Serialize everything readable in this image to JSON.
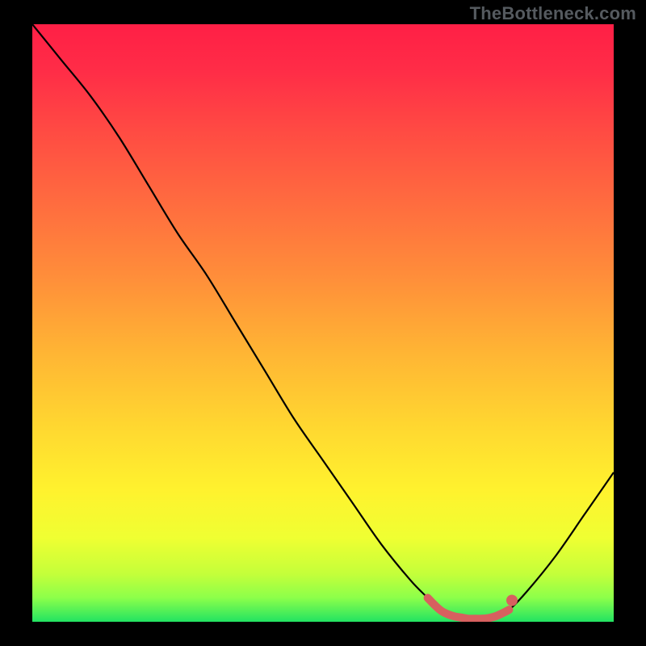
{
  "watermark": {
    "text": "TheBottleneck.com"
  },
  "chart_data": {
    "type": "line",
    "title": "",
    "xlabel": "",
    "ylabel": "",
    "xlim": [
      0,
      100
    ],
    "ylim": [
      0,
      100
    ],
    "x": [
      0,
      5,
      10,
      15,
      20,
      25,
      30,
      35,
      40,
      45,
      50,
      55,
      60,
      65,
      68,
      70,
      72,
      75,
      78,
      80,
      82,
      85,
      90,
      95,
      100
    ],
    "values": [
      100,
      94,
      88,
      81,
      73,
      65,
      58,
      50,
      42,
      34,
      27,
      20,
      13,
      7,
      4,
      2,
      1,
      0.5,
      0.5,
      1,
      2,
      5,
      11,
      18,
      25
    ],
    "highlight_range_x": [
      68,
      82
    ],
    "background_gradient": {
      "stops": [
        {
          "offset": 0.0,
          "color": "#ff1f46"
        },
        {
          "offset": 0.08,
          "color": "#ff2d47"
        },
        {
          "offset": 0.18,
          "color": "#ff4b43"
        },
        {
          "offset": 0.3,
          "color": "#ff6c3f"
        },
        {
          "offset": 0.42,
          "color": "#ff8d3a"
        },
        {
          "offset": 0.55,
          "color": "#ffb534"
        },
        {
          "offset": 0.68,
          "color": "#ffd930"
        },
        {
          "offset": 0.78,
          "color": "#fff22e"
        },
        {
          "offset": 0.86,
          "color": "#efff32"
        },
        {
          "offset": 0.92,
          "color": "#c4ff3a"
        },
        {
          "offset": 0.96,
          "color": "#8cff4a"
        },
        {
          "offset": 1.0,
          "color": "#22e362"
        }
      ]
    },
    "highlight_color": "#d7605f",
    "curve_color": "#000000"
  }
}
